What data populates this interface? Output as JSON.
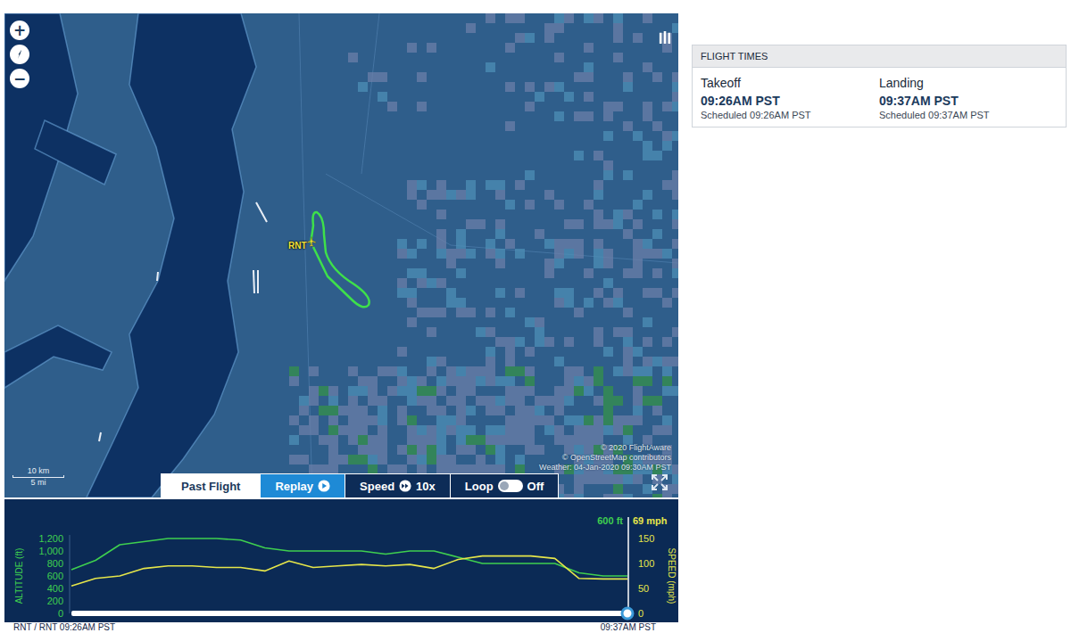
{
  "map": {
    "airport_label": "RNT",
    "zoom_controls": [
      "+",
      "−"
    ],
    "scale": {
      "metric": "10 km",
      "imperial": "5 mi"
    },
    "attribution": [
      "© 2020 FlightAware",
      "© OpenStreetMap contributors",
      "Weather: 04-Jan-2020 09:30AM PST"
    ]
  },
  "playback": {
    "mode": "Past Flight",
    "replay": "Replay",
    "speed_label": "Speed",
    "speed": "10x",
    "loop_label": "Loop",
    "loop_on": false,
    "loop_state": "Off"
  },
  "chart": {
    "altitude_axis": {
      "title": "ALTITUDE (ft)",
      "ticks": [
        "1,200",
        "1,000",
        "800",
        "600",
        "400",
        "200",
        "0"
      ]
    },
    "speed_axis": {
      "title": "SPEED (mph)",
      "ticks": [
        "150",
        "100",
        "50",
        "0"
      ]
    },
    "series": [
      {
        "name": "altitude",
        "color": "#3fcf4f",
        "values": [
          700,
          850,
          1100,
          1150,
          1200,
          1200,
          1200,
          1175,
          1050,
          1000,
          1000,
          1000,
          1000,
          950,
          1000,
          1000,
          900,
          800,
          800,
          800,
          800,
          650,
          600,
          600
        ]
      },
      {
        "name": "speed",
        "color": "#e6e64a",
        "values": [
          55,
          70,
          75,
          90,
          95,
          95,
          92,
          92,
          85,
          105,
          92,
          95,
          98,
          95,
          98,
          90,
          108,
          115,
          115,
          115,
          110,
          70,
          69,
          69
        ]
      }
    ],
    "readouts": {
      "altitude": "600 ft",
      "speed": "69 mph"
    },
    "timeline": {
      "start_label": "RNT / RNT 09:26AM PST",
      "end_label": "09:37AM PST",
      "level": 1
    }
  },
  "flight_times": {
    "title": "FLIGHT TIMES",
    "columns": [
      {
        "label": "Takeoff",
        "time": "09:26AM PST",
        "scheduled": "Scheduled 09:26AM PST"
      },
      {
        "label": "Landing",
        "time": "09:37AM PST",
        "scheduled": "Scheduled 09:37AM PST"
      }
    ]
  }
}
